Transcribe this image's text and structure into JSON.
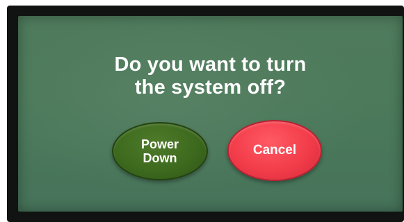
{
  "dialog": {
    "prompt_line1": "Do you want to turn",
    "prompt_line2": "the system off?",
    "power_down": {
      "line1": "Power",
      "line2": "Down"
    },
    "cancel_label": "Cancel"
  },
  "colors": {
    "screen_background": "#4c7a5a",
    "power_down_button": "#3d6a1e",
    "cancel_button": "#f23c4a",
    "text": "#ffffff"
  }
}
